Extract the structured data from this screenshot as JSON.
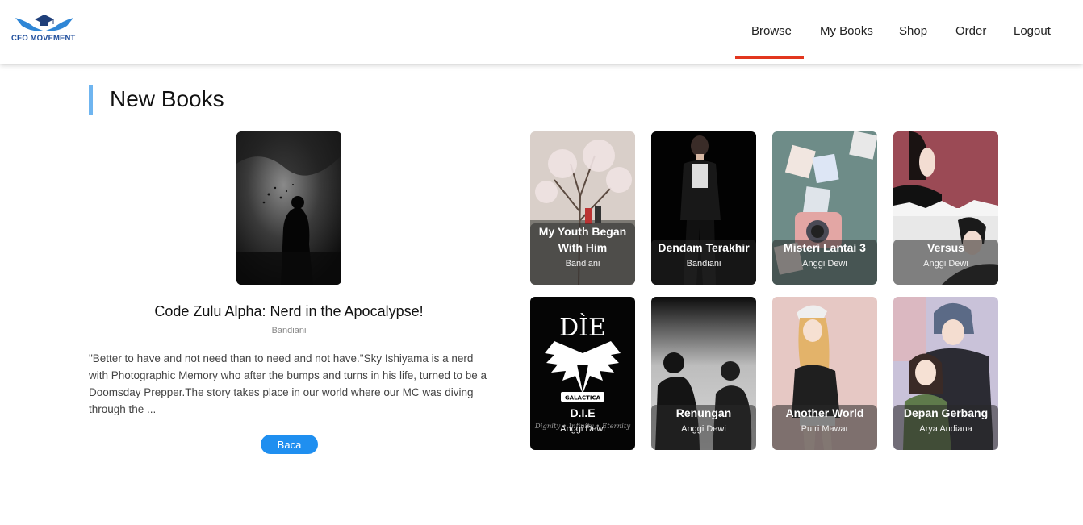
{
  "brand": {
    "name": "CEO MOVEMENT"
  },
  "nav": {
    "items": [
      {
        "label": "Browse",
        "active": true
      },
      {
        "label": "My Books"
      },
      {
        "label": "Shop"
      },
      {
        "label": "Order"
      },
      {
        "label": "Logout"
      }
    ],
    "active_color": "#e2361e"
  },
  "section": {
    "title": "New Books",
    "accent_color": "#6fb5f0"
  },
  "featured": {
    "title": "Code Zulu Alpha: Nerd in the Apocalypse!",
    "author": "Bandiani",
    "description": "\"Better to have and not need than to need and not have.\"Sky Ishiyama is a nerd with Photographic Memory who after the bumps and turns in his life, turned to be a Doomsday Prepper.The story takes place in our world where our MC was diving through the ...",
    "button_label": "Baca",
    "button_color": "#1f8ff0"
  },
  "books": [
    {
      "title": "My Youth Began With Him",
      "author": "Bandiani"
    },
    {
      "title": "Dendam Terakhir",
      "author": "Bandiani"
    },
    {
      "title": "Misteri Lantai 3",
      "author": "Anggi Dewi"
    },
    {
      "title": "Versus",
      "author": "Anggi Dewi"
    },
    {
      "title": "D.I.E",
      "author": "Anggi Dewi",
      "cover_text": "DÌE",
      "cover_badge": "GALACTICA",
      "cover_tagline": "Dignity • Infinity • Eternity"
    },
    {
      "title": "Renungan",
      "author": "Anggi Dewi"
    },
    {
      "title": "Another World",
      "author": "Putri Mawar"
    },
    {
      "title": "Depan Gerbang",
      "author": "Arya Andiana"
    }
  ]
}
